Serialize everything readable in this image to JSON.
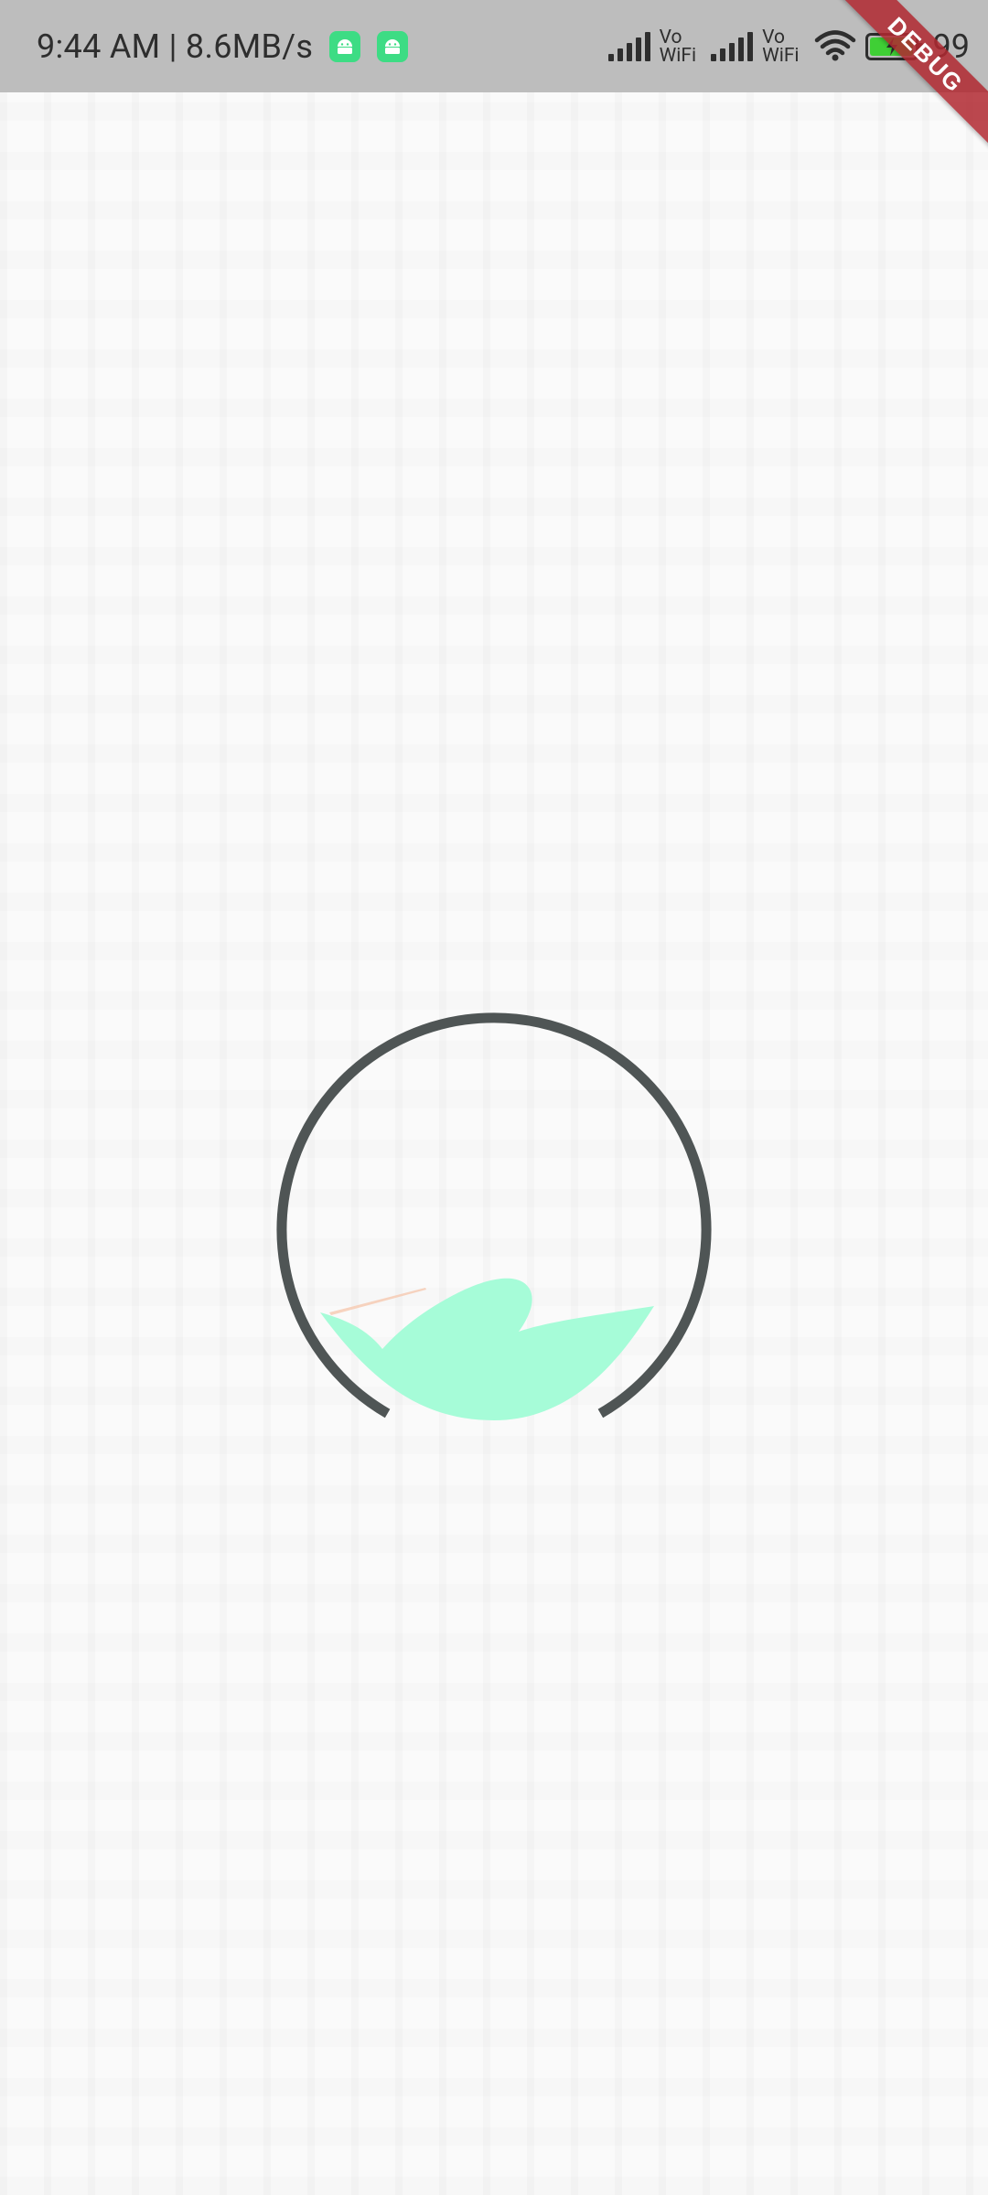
{
  "status_bar": {
    "time_speed": "9:44 AM | 8.6MB/s",
    "notif_icons": [
      "android-icon",
      "android-icon"
    ],
    "vowifi_1": {
      "top": "Vo",
      "bottom": "WiFi"
    },
    "vowifi_2": {
      "top": "Vo",
      "bottom": "WiFi"
    },
    "battery_level": 0.99,
    "battery_pct": "99"
  },
  "debug_banner": {
    "label": "DEBUG"
  },
  "loader": {
    "icon": "progress-ring-with-leaf-wave",
    "ring_color": "#4f5555",
    "wave_color": "#a6fcd8",
    "streak_color": "#f6cbb4"
  },
  "colors": {
    "background": "#fafafa",
    "status_bar": "#bdbdbd",
    "debug_banner": "#b02830"
  }
}
